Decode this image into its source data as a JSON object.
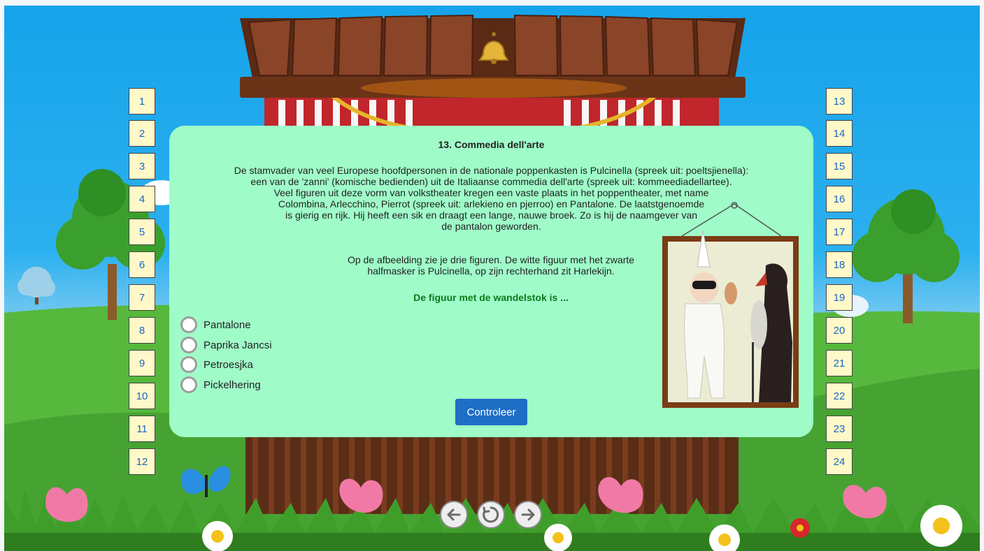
{
  "question": {
    "title": "13. Commedia dell'arte",
    "paragraph1_lines": [
      "De stamvader van veel Europese hoofdpersonen in de nationale poppenkasten is Pulcinella (spreek uit: poeltsjienella):",
      "een van de 'zanni' (komische bedienden) uit de Italiaanse commedia dell'arte (spreek uit: kommeediadellartee).",
      "Veel figuren uit deze vorm van volkstheater kregen een vaste plaats in het poppentheater, met name",
      "Colombina, Arlecchino, Pierrot (spreek uit: arlekieno en pjerroo) en Pantalone. De laatstgenoemde",
      "is gierig en rijk. Hij heeft een sik en draagt een lange, nauwe broek. Zo is hij de naamgever van",
      "de pantalon geworden."
    ],
    "paragraph2_lines": [
      "Op de afbeelding zie je drie figuren. De witte figuur met het zwarte",
      "halfmasker is Pulcinella, op zijn rechterhand zit Harlekijn."
    ],
    "prompt": "De figuur met de wandelstok is ...",
    "options": [
      "Pantalone",
      "Paprika Jancsi",
      "Petroesjka",
      "Pickelhering"
    ],
    "check_label": "Controleer"
  },
  "left_numbers": [
    "1",
    "2",
    "3",
    "4",
    "5",
    "6",
    "7",
    "8",
    "9",
    "10",
    "11",
    "12"
  ],
  "right_numbers": [
    "13",
    "14",
    "15",
    "16",
    "17",
    "18",
    "19",
    "20",
    "21",
    "22",
    "23",
    "24"
  ],
  "nav": {
    "prev_icon": "arrow-left-icon",
    "reset_icon": "reset-icon",
    "next_icon": "arrow-right-icon"
  },
  "colors": {
    "panel": "#9ffcc8",
    "prompt": "#0f7a1c",
    "button": "#1e6ec6",
    "number_box": "#fff9c9",
    "number_text": "#1b64c8"
  }
}
